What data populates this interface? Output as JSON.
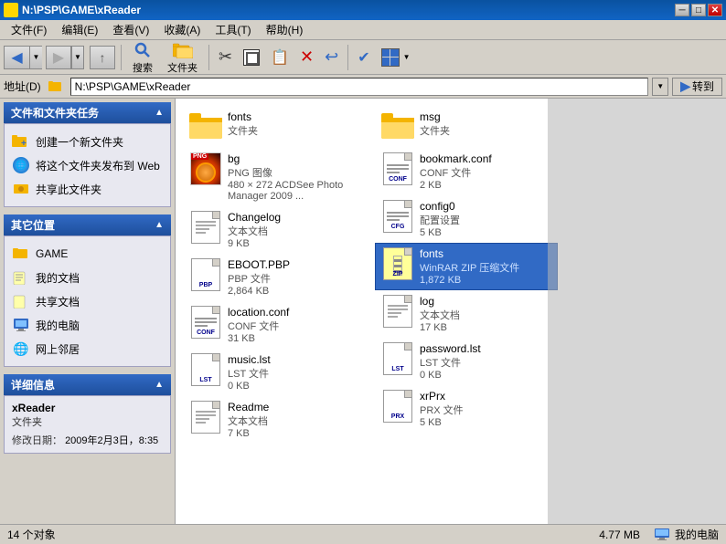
{
  "titlebar": {
    "title": "N:\\PSP\\GAME\\xReader",
    "min_label": "─",
    "restore_label": "□",
    "close_label": "✕"
  },
  "menubar": {
    "items": [
      {
        "label": "文件(F)"
      },
      {
        "label": "编辑(E)"
      },
      {
        "label": "查看(V)"
      },
      {
        "label": "收藏(A)"
      },
      {
        "label": "工具(T)"
      },
      {
        "label": "帮助(H)"
      }
    ]
  },
  "toolbar": {
    "back_label": "后退",
    "search_label": "搜索",
    "folders_label": "文件夹"
  },
  "addressbar": {
    "label": "地址(D)",
    "path": "N:\\PSP\\GAME\\xReader",
    "goto_label": "转到"
  },
  "left_panel": {
    "tasks_header": "文件和文件夹任务",
    "tasks": [
      {
        "label": "创建一个新文件夹"
      },
      {
        "label": "将这个文件夹发布到 Web"
      },
      {
        "label": "共享此文件夹"
      }
    ],
    "other_header": "其它位置",
    "other": [
      {
        "label": "GAME"
      },
      {
        "label": "我的文档"
      },
      {
        "label": "共享文档"
      },
      {
        "label": "我的电脑"
      },
      {
        "label": "网上邻居"
      }
    ],
    "detail_header": "详细信息",
    "detail": {
      "name": "xReader",
      "type": "文件夹",
      "modified_label": "修改日期：",
      "modified_value": "2009年2月3日，8:35"
    }
  },
  "files": [
    {
      "name": "fonts",
      "type": "文件夹",
      "size": "",
      "icon": "folder",
      "row": 0,
      "col": 0
    },
    {
      "name": "msg",
      "type": "文件夹",
      "size": "",
      "icon": "folder",
      "row": 0,
      "col": 1
    },
    {
      "name": "bg",
      "type": "PNG 图像",
      "size": "480 × 272\nACDSee Photo Manager 2009 ...",
      "icon": "png",
      "row": 1,
      "col": 0
    },
    {
      "name": "bookmark.conf",
      "type": "CONF 文件",
      "size": "2 KB",
      "icon": "conf",
      "row": 1,
      "col": 1
    },
    {
      "name": "Changelog",
      "type": "文本文档",
      "size": "9 KB",
      "icon": "text",
      "row": 2,
      "col": 0
    },
    {
      "name": "config0",
      "type": "配置设置",
      "size": "5 KB",
      "icon": "conf2",
      "row": 2,
      "col": 1
    },
    {
      "name": "EBOOT.PBP",
      "type": "PBP 文件",
      "size": "2,864 KB",
      "icon": "pbp",
      "row": 3,
      "col": 0
    },
    {
      "name": "fonts",
      "type": "WinRAR ZIP 压缩文件",
      "size": "1,872 KB",
      "icon": "zip",
      "row": 3,
      "col": 1
    },
    {
      "name": "location.conf",
      "type": "CONF 文件",
      "size": "31 KB",
      "icon": "conf",
      "row": 4,
      "col": 0
    },
    {
      "name": "log",
      "type": "文本文档",
      "size": "17 KB",
      "icon": "text",
      "row": 4,
      "col": 1
    },
    {
      "name": "music.lst",
      "type": "LST 文件",
      "size": "0 KB",
      "icon": "lst",
      "row": 5,
      "col": 0
    },
    {
      "name": "password.lst",
      "type": "LST 文件",
      "size": "0 KB",
      "icon": "lst",
      "row": 5,
      "col": 1
    },
    {
      "name": "Readme",
      "type": "文本文档",
      "size": "7 KB",
      "icon": "text",
      "row": 6,
      "col": 0
    },
    {
      "name": "xrPrx",
      "type": "PRX 文件",
      "size": "5 KB",
      "icon": "prx",
      "row": 6,
      "col": 1
    }
  ],
  "statusbar": {
    "items_label": "14 个对象",
    "size_label": "4.77 MB",
    "computer_label": "我的电脑"
  }
}
